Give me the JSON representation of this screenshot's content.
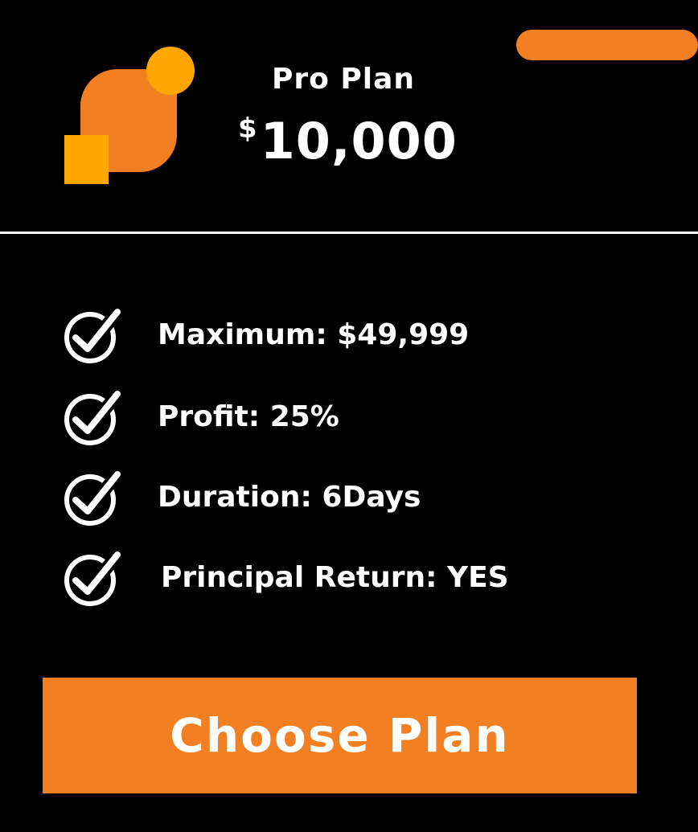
{
  "plan": {
    "name": "Pro Plan",
    "currency": "$",
    "amount": "10,000"
  },
  "features": [
    {
      "label": "Maximum: $49,999",
      "icon": "check-circle-icon"
    },
    {
      "label": "Profit: 25%",
      "icon": "check-circle-icon"
    },
    {
      "label": "Duration: 6Days",
      "icon": "check-circle-icon"
    },
    {
      "label": "Principal Return: YES",
      "icon": "check-circle-icon"
    }
  ],
  "cta": {
    "label": "Choose Plan"
  },
  "colors": {
    "accent": "#f27f22",
    "accent_yellow": "#ffa600",
    "background": "#000000",
    "text": "#ffffff"
  }
}
